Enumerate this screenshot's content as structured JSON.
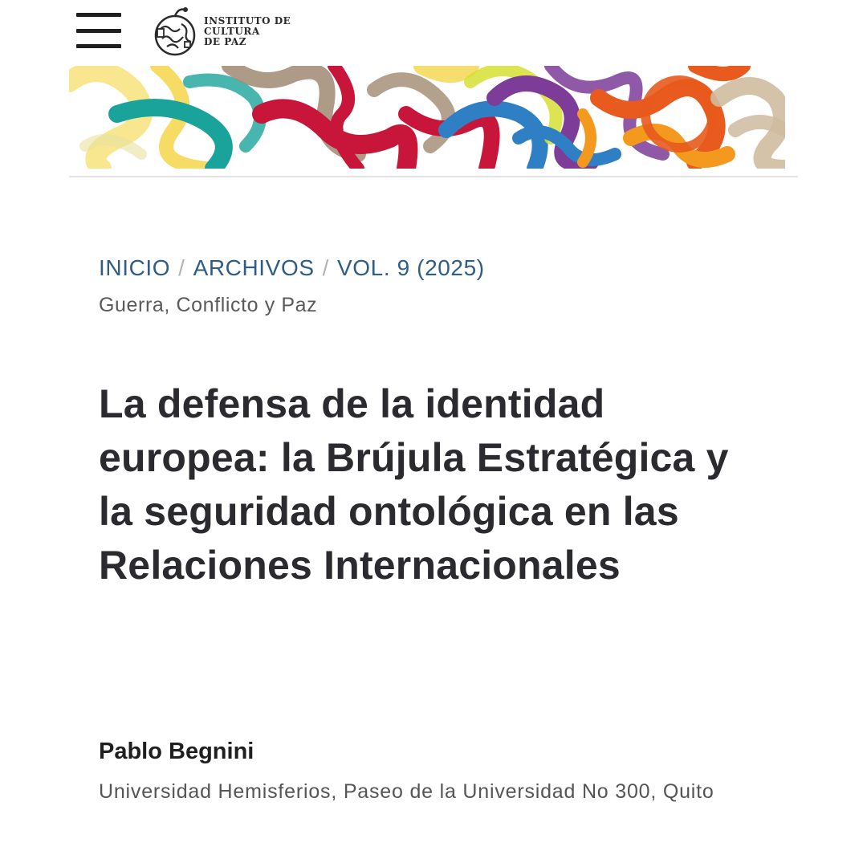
{
  "header": {
    "menu_icon": "hamburger-menu-icon",
    "logo": {
      "icon": "pipe-seal-logo-icon",
      "lines": [
        "INSTITUTO DE",
        "CULTURA",
        "DE PAZ"
      ]
    }
  },
  "banner": {
    "icon": "colorful-abstract-pattern",
    "colors": [
      "#f4d64a",
      "#1aa39a",
      "#c8163a",
      "#a08a72",
      "#2e7fc4",
      "#7d3c98",
      "#e85a1d",
      "#f39a1e",
      "#cfbba0"
    ]
  },
  "breadcrumb": {
    "items": [
      "INICIO",
      "ARCHIVOS",
      "VOL. 9 (2025)"
    ],
    "separator": "/"
  },
  "section": "Guerra, Conflicto y Paz",
  "article": {
    "title": "La defensa de la identidad europea: la Brújula Estratégica y la seguridad ontológica en las Relaciones Internacionales",
    "author": "Pablo Begnini",
    "affiliation": "Universidad Hemisferios, Paseo de la Universidad No 300, Quito"
  },
  "colors": {
    "link": "#2f5d86",
    "title": "#2b2b2f",
    "muted": "#555555"
  }
}
